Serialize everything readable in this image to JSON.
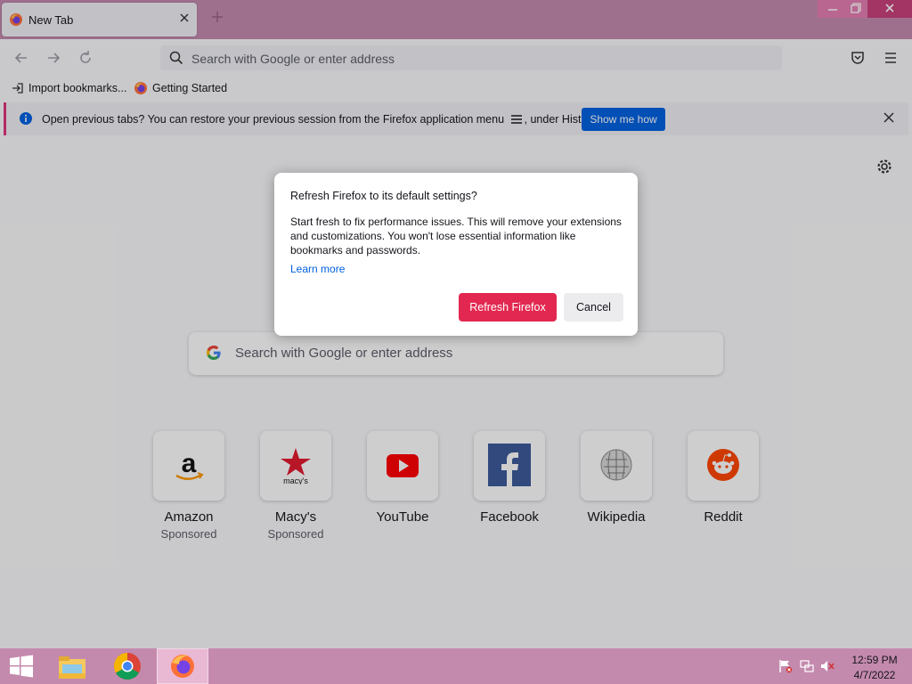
{
  "browser": {
    "tab_title": "New Tab",
    "url_placeholder": "Search with Google or enter address",
    "bookmarks": [
      {
        "label": "Import bookmarks...",
        "icon": "import-icon"
      },
      {
        "label": "Getting Started",
        "icon": "firefox-icon"
      }
    ],
    "notification": {
      "message": "Open previous tabs? You can restore your previous session from the Firefox application menu",
      "message_suffix": ", under History.",
      "button_label": "Show me how"
    }
  },
  "newtab": {
    "search_placeholder": "Search with Google or enter address",
    "tiles": [
      {
        "name": "Amazon",
        "sponsored": "Sponsored",
        "icon": "amazon-icon"
      },
      {
        "name": "Macy's",
        "sponsored": "Sponsored",
        "icon": "macys-icon"
      },
      {
        "name": "YouTube",
        "sponsored": "",
        "icon": "youtube-icon"
      },
      {
        "name": "Facebook",
        "sponsored": "",
        "icon": "facebook-icon"
      },
      {
        "name": "Wikipedia",
        "sponsored": "",
        "icon": "wikipedia-icon"
      },
      {
        "name": "Reddit",
        "sponsored": "",
        "icon": "reddit-icon"
      }
    ]
  },
  "dialog": {
    "title": "Refresh Firefox to its default settings?",
    "body": "Start fresh to fix performance issues. This will remove your extensions and customizations. You won't lose essential information like bookmarks and passwords.",
    "link": "Learn more",
    "primary_button": "Refresh Firefox",
    "cancel_button": "Cancel"
  },
  "taskbar": {
    "time": "12:59 PM",
    "date": "4/7/2022"
  },
  "colors": {
    "accent_primary": "#e22850",
    "notification_button": "#0061e0",
    "theme_frame": "#c48aae"
  }
}
